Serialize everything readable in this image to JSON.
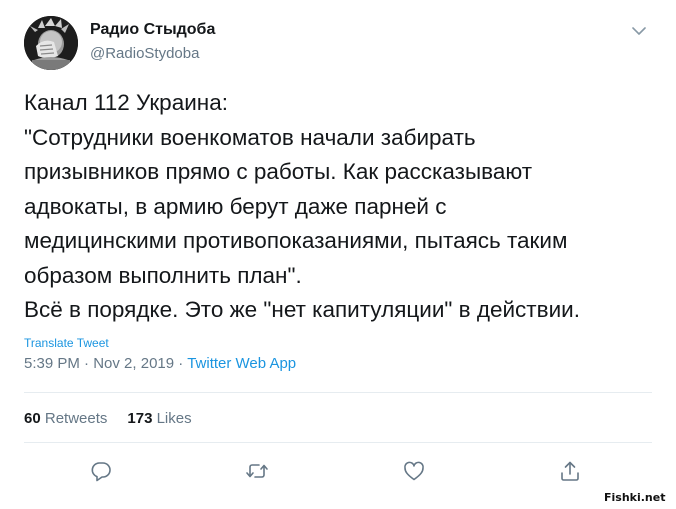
{
  "author": {
    "display_name": "Радио Стыдоба",
    "handle": "@RadioStydoba",
    "avatar_icon": "statue-of-liberty-facepalm-avatar"
  },
  "tweet": {
    "lines": [
      "Канал 112 Украина:",
      "\"Сотрудники военкоматов начали забирать",
      "призывников прямо с работы. Как рассказывают",
      "адвокаты, в армию берут даже парней с",
      "медицинскими противопоказаниями, пытаясь таким",
      "образом выполнить план\".",
      "Всё в порядке. Это же \"нет капитуляции\" в действии."
    ],
    "translate_label": "Translate Tweet",
    "time": "5:39 PM",
    "date": "Nov 2, 2019",
    "separator": "·",
    "source": "Twitter Web App"
  },
  "stats": {
    "retweets_count": "60",
    "retweets_label": "Retweets",
    "likes_count": "173",
    "likes_label": "Likes"
  },
  "actions": {
    "reply_icon": "reply-icon",
    "retweet_icon": "retweet-icon",
    "like_icon": "like-icon",
    "share_icon": "share-icon",
    "more_icon": "chevron-down-icon"
  },
  "watermark": "Fishki.net",
  "colors": {
    "text": "#14171a",
    "muted": "#657786",
    "link": "#1b95e0",
    "divider": "#e6ecf0"
  }
}
